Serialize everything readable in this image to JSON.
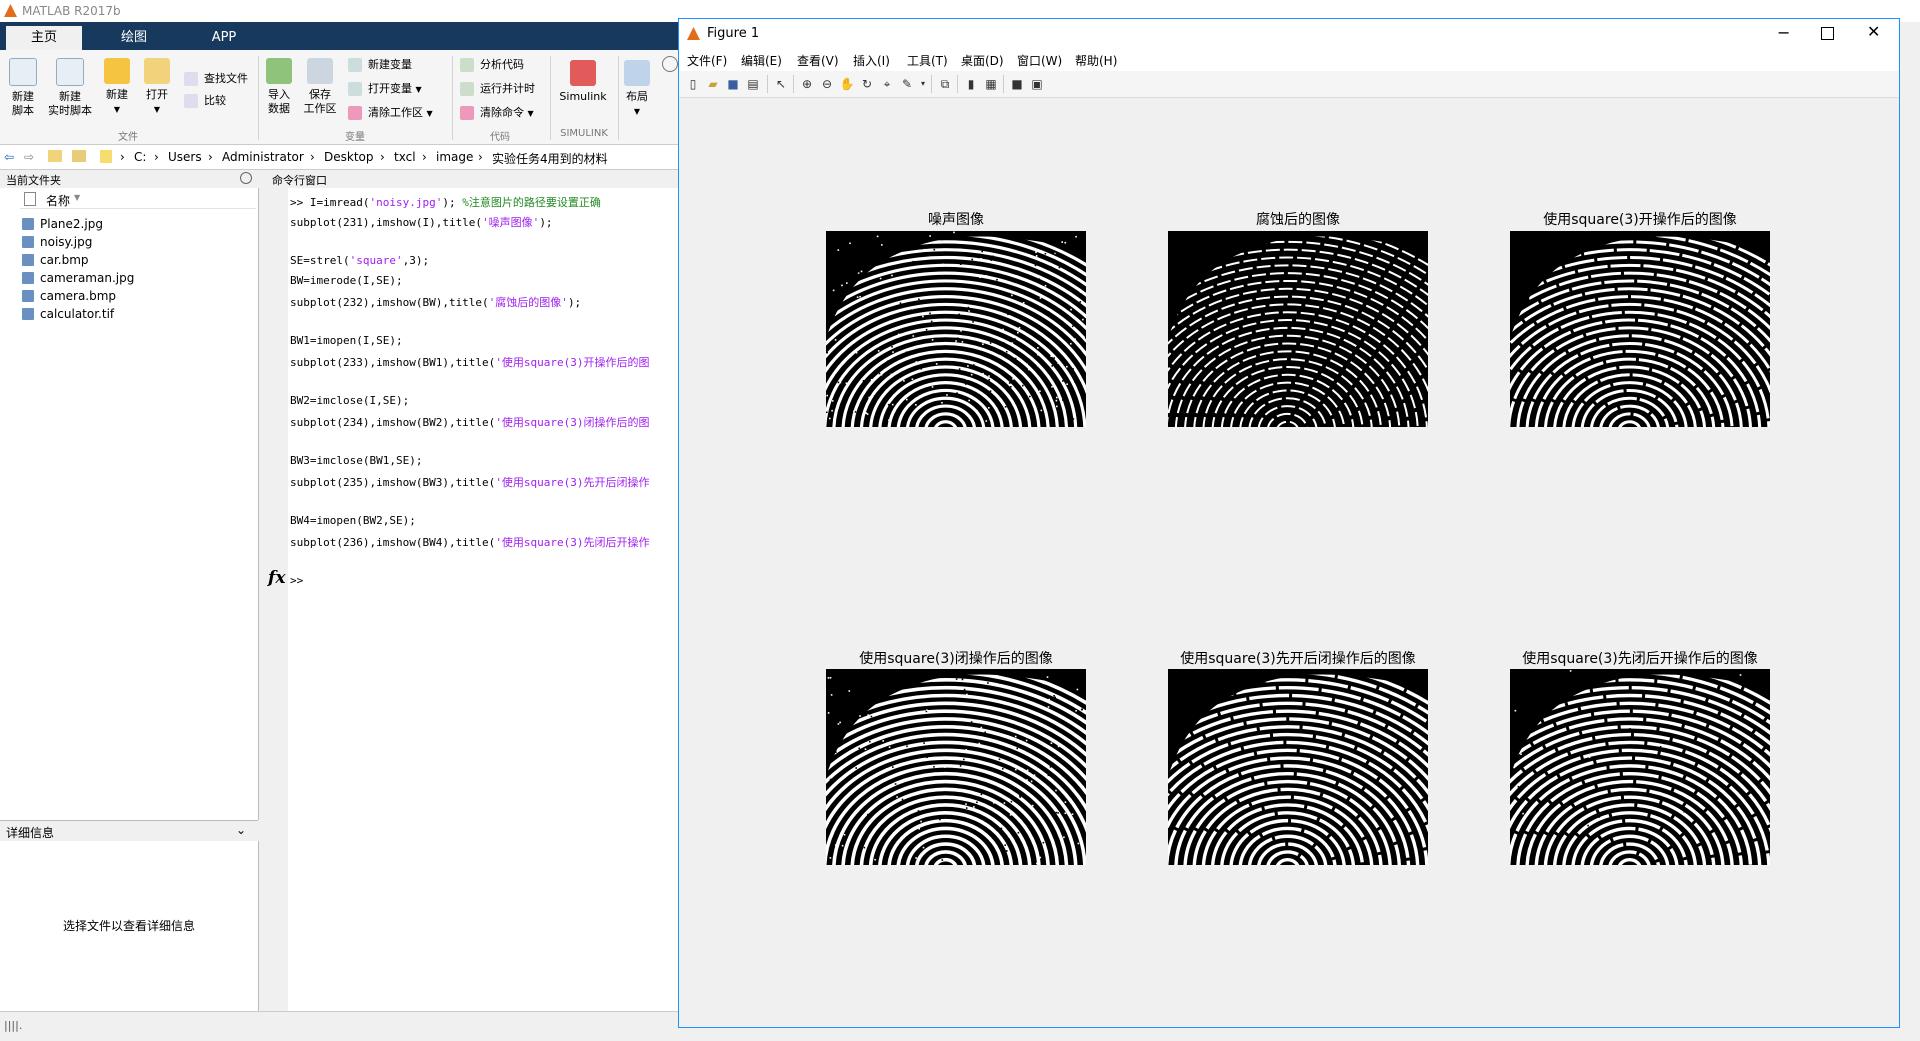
{
  "app": {
    "title": "MATLAB R2017b",
    "tabs": [
      "主页",
      "绘图",
      "APP"
    ],
    "ribbon": {
      "new_script": "新建\n脚本",
      "new_live_script": "新建\n实时脚本",
      "new": "新建",
      "open": "打开",
      "find_files": "查找文件",
      "compare": "比较",
      "import_data": "导入\n数据",
      "save_workspace": "保存\n工作区",
      "new_variable": "新建变量",
      "open_variable": "打开变量",
      "clear_workspace": "清除工作区",
      "analyze_code": "分析代码",
      "run_and_time": "运行并计时",
      "clear_commands": "清除命令",
      "simulink": "Simulink",
      "layout": "布局",
      "groups": {
        "file": "文件",
        "variable": "变量",
        "code": "代码",
        "simulink": "SIMULINK"
      }
    },
    "path": [
      "C:",
      "Users",
      "Administrator",
      "Desktop",
      "txcl",
      "image",
      "实验任务4用到的材料"
    ]
  },
  "current_folder": {
    "title": "当前文件夹",
    "column": "名称",
    "files": [
      {
        "name": "Plane2.jpg",
        "type": "image"
      },
      {
        "name": "noisy.jpg",
        "type": "image"
      },
      {
        "name": "car.bmp",
        "type": "image"
      },
      {
        "name": "cameraman.jpg",
        "type": "image"
      },
      {
        "name": "camera.bmp",
        "type": "image"
      },
      {
        "name": "calculator.tif",
        "type": "image"
      }
    ]
  },
  "details": {
    "title": "详细信息",
    "message": "选择文件以查看详细信息"
  },
  "command_window": {
    "title": "命令行窗口",
    "lines": [
      {
        "prompt": ">> ",
        "code": "I=imread(",
        "str": "'noisy.jpg'",
        "tail": "); ",
        "comment": "%注意图片的路径要设置正确"
      },
      {
        "prompt": "",
        "code": "subplot(231),imshow(I),title(",
        "str": "'噪声图像'",
        "tail": ");",
        "comment": ""
      },
      {
        "prompt": "",
        "code": "",
        "str": "",
        "tail": "",
        "comment": ""
      },
      {
        "prompt": "",
        "code": "SE=strel(",
        "str": "'square'",
        "tail": ",3);",
        "comment": ""
      },
      {
        "prompt": "",
        "code": "BW=imerode(I,SE);",
        "str": "",
        "tail": "",
        "comment": ""
      },
      {
        "prompt": "",
        "code": "subplot(232),imshow(BW),title(",
        "str": "'腐蚀后的图像'",
        "tail": ");",
        "comment": ""
      },
      {
        "prompt": "",
        "code": "",
        "str": "",
        "tail": "",
        "comment": ""
      },
      {
        "prompt": "",
        "code": "BW1=imopen(I,SE);",
        "str": "",
        "tail": "",
        "comment": ""
      },
      {
        "prompt": "",
        "code": "subplot(233),imshow(BW1),title(",
        "str": "'使用square(3)开操作后的图",
        "tail": "",
        "comment": ""
      },
      {
        "prompt": "",
        "code": "",
        "str": "",
        "tail": "",
        "comment": ""
      },
      {
        "prompt": "",
        "code": "BW2=imclose(I,SE);",
        "str": "",
        "tail": "",
        "comment": ""
      },
      {
        "prompt": "",
        "code": "subplot(234),imshow(BW2),title(",
        "str": "'使用square(3)闭操作后的图",
        "tail": "",
        "comment": ""
      },
      {
        "prompt": "",
        "code": "",
        "str": "",
        "tail": "",
        "comment": ""
      },
      {
        "prompt": "",
        "code": "BW3=imclose(BW1,SE);",
        "str": "",
        "tail": "",
        "comment": ""
      },
      {
        "prompt": "",
        "code": "subplot(235),imshow(BW3),title(",
        "str": "'使用square(3)先开后闭操作",
        "tail": "",
        "comment": ""
      },
      {
        "prompt": "",
        "code": "",
        "str": "",
        "tail": "",
        "comment": ""
      },
      {
        "prompt": "",
        "code": "BW4=imopen(BW2,SE);",
        "str": "",
        "tail": "",
        "comment": ""
      },
      {
        "prompt": "",
        "code": "subplot(236),imshow(BW4),title(",
        "str": "'使用square(3)先闭后开操作",
        "tail": "",
        "comment": ""
      }
    ],
    "fx": "fx",
    "prompt": ">>"
  },
  "figure": {
    "title": "Figure 1",
    "menus": [
      "文件(F)",
      "编辑(E)",
      "查看(V)",
      "插入(I)",
      "工具(T)",
      "桌面(D)",
      "窗口(W)",
      "帮助(H)"
    ],
    "subplots": [
      {
        "title": "噪声图像",
        "variant": "noisy"
      },
      {
        "title": "腐蚀后的图像",
        "variant": "eroded"
      },
      {
        "title": "使用square(3)开操作后的图像",
        "variant": "open"
      },
      {
        "title": "使用square(3)闭操作后的图像",
        "variant": "close"
      },
      {
        "title": "使用square(3)先开后闭操作后的图像",
        "variant": "openclose"
      },
      {
        "title": "使用square(3)先闭后开操作后的图像",
        "variant": "closeopen"
      }
    ]
  },
  "colors": {
    "tab_bar": "#16395d",
    "string": "#a020f0",
    "comment": "#228b22"
  }
}
